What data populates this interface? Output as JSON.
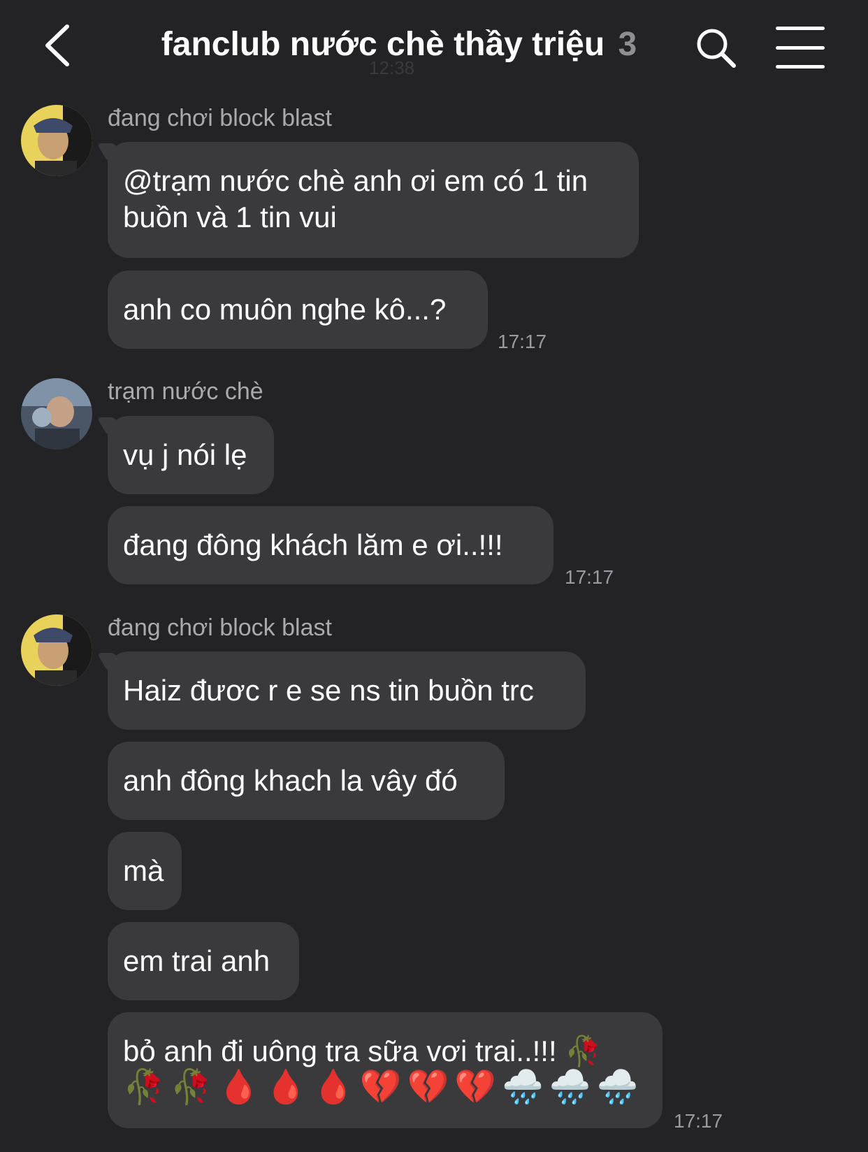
{
  "header": {
    "title": "fanclub nước chè thầy triệu",
    "member_count": "3",
    "ghost_time": "12:38"
  },
  "messages": [
    {
      "sender": "đang chơi block blast",
      "bubbles": [
        "@trạm nước chè anh ơi em có 1 tin buồn và 1 tin vui",
        "anh co muôn nghe kô...?"
      ],
      "time": "17:17"
    },
    {
      "sender": "trạm nước chè",
      "bubbles": [
        "vụ j nói lẹ",
        "đang đông khách lăm e ơi..!!!"
      ],
      "time": "17:17"
    },
    {
      "sender": "đang chơi block blast",
      "bubbles": [
        "Haiz đươc r e se ns tin buồn trc",
        "anh đông khach la vây đó",
        "mà",
        "em trai anh",
        "bỏ anh đi uông tra sữa vơi trai..!!! 🥀"
      ],
      "emoji_line": "🥀🥀🩸🩸🩸💔💔💔🌧️🌧️🌧️",
      "time": "17:17"
    }
  ],
  "colors": {
    "background": "#232326",
    "bubble": "#3a3a3d",
    "sender_name": "#a9a9ae",
    "timestamp": "#9a9aa0"
  }
}
